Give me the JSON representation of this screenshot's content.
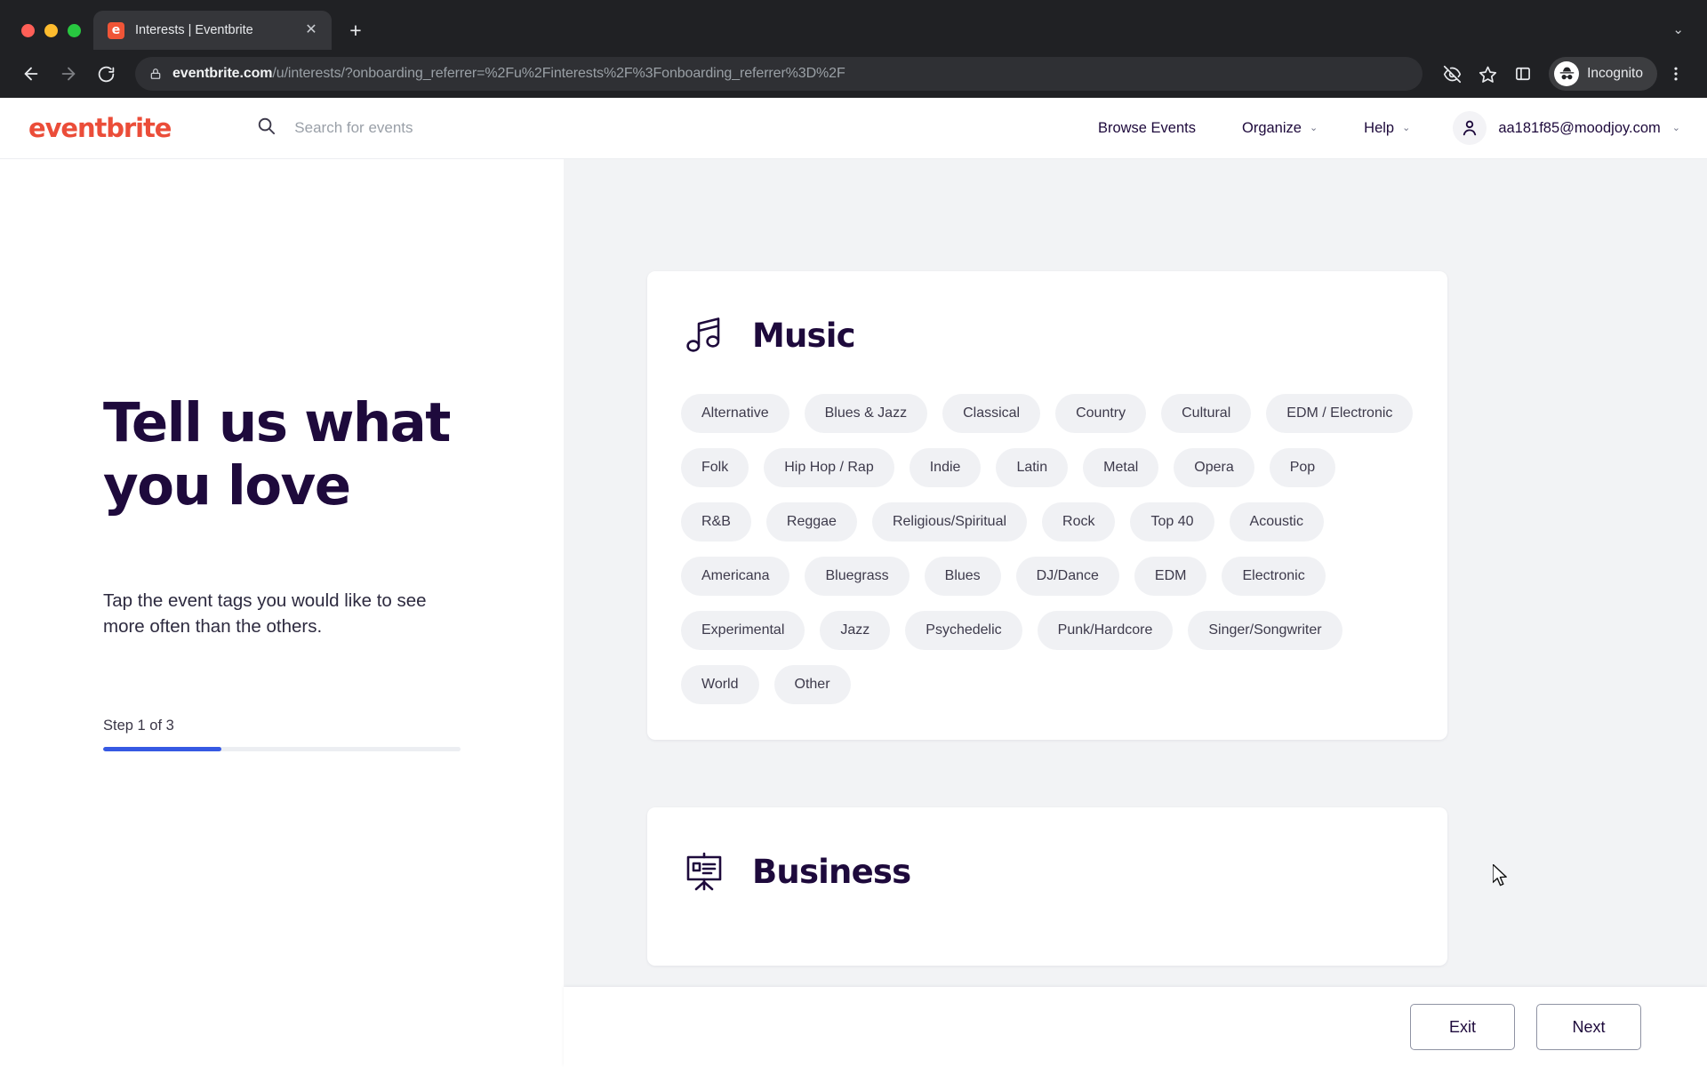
{
  "browser": {
    "tab": {
      "title": "Interests | Eventbrite",
      "favicon": "eventbrite-favicon",
      "close_label": "✕"
    },
    "new_tab_label": "+",
    "tab_list_caret": "⌄",
    "url": {
      "host": "eventbrite.com",
      "path": "/u/interests/?onboarding_referrer=%2Fu%2Finterests%2F%3Fonboarding_referrer%3D%2F"
    },
    "profile": {
      "label": "Incognito"
    }
  },
  "site_header": {
    "logo": "eventbrite",
    "search_placeholder": "Search for events",
    "nav": [
      {
        "label": "Browse Events",
        "caret": ""
      },
      {
        "label": "Organize",
        "caret": "⌄"
      },
      {
        "label": "Help",
        "caret": "⌄"
      }
    ],
    "account": {
      "email": "aa181f85@moodjoy.com",
      "caret": "⌄"
    }
  },
  "left_pane": {
    "headline": "Tell us what you love",
    "subtext": "Tap the event tags you would like to see more often than the others.",
    "step_label": "Step 1 of 3",
    "progress_percent": 33,
    "progress_color": "#3659e3"
  },
  "categories": [
    {
      "name": "Music",
      "icon": "music-note-icon",
      "tag_rows": [
        [
          "Alternative",
          "Blues & Jazz",
          "Classical",
          "Country",
          "Cultural",
          "EDM / Electronic"
        ],
        [
          "Folk",
          "Hip Hop / Rap",
          "Indie",
          "Latin",
          "Metal",
          "Opera",
          "Pop"
        ],
        [
          "R&B",
          "Reggae",
          "Religious/Spiritual",
          "Rock",
          "Top 40",
          "Acoustic"
        ],
        [
          "Americana",
          "Bluegrass",
          "Blues",
          "DJ/Dance",
          "EDM",
          "Electronic"
        ],
        [
          "Experimental",
          "Jazz",
          "Psychedelic",
          "Punk/Hardcore",
          "Singer/Songwriter"
        ],
        [
          "World",
          "Other"
        ]
      ]
    },
    {
      "name": "Business",
      "icon": "presentation-board-icon",
      "tag_rows": []
    }
  ],
  "footer": {
    "exit_label": "Exit",
    "next_label": "Next"
  }
}
